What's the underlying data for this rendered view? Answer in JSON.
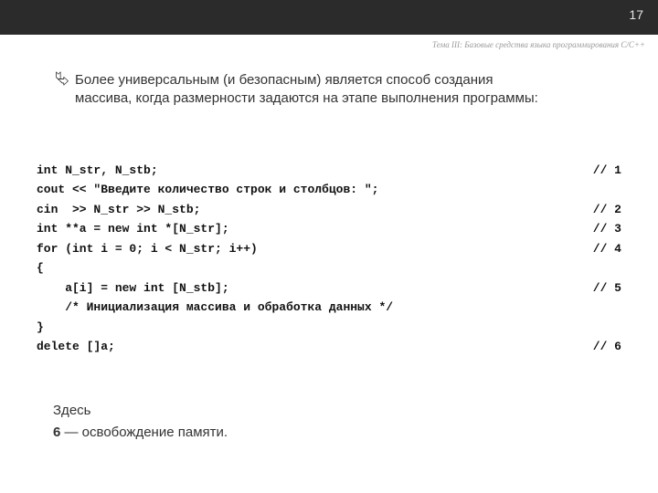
{
  "page_number": "17",
  "header_subtitle": "Тема III: Базовые средства языка программирования C/C++",
  "bullet_glyph": "⮱",
  "intro_line1": "Более универсальным (и безопасным) является способ создания",
  "intro_line2": "массива, когда размерности задаются на этапе выполнения программы:",
  "code": [
    {
      "left": "int N_str, N_stb;",
      "right": "// 1"
    },
    {
      "left": "cout << \"Введите количество строк и столбцов: \";",
      "right": ""
    },
    {
      "left": "cin  >> N_str >> N_stb;",
      "right": "// 2"
    },
    {
      "left": "int **a = new int *[N_str];",
      "right": "// 3"
    },
    {
      "left": "for (int i = 0; i < N_str; i++)",
      "right": "// 4"
    },
    {
      "left": "{",
      "right": ""
    },
    {
      "left": "    a[i] = new int [N_stb];",
      "right": "// 5"
    },
    {
      "left": "    /* Инициализация массива и обработка данных */",
      "right": ""
    },
    {
      "left": "}",
      "right": ""
    },
    {
      "left": "delete []a;",
      "right": "// 6"
    }
  ],
  "footer_label": "Здесь",
  "footer_point_num": "6",
  "footer_point_text": " — освобождение памяти."
}
